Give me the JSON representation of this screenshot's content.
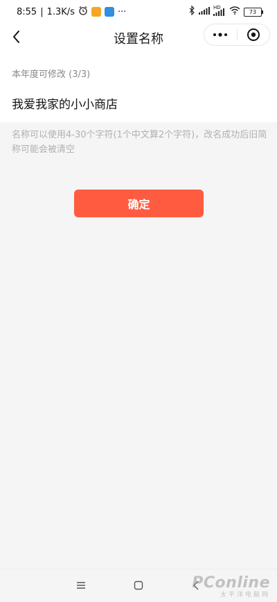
{
  "status_bar": {
    "time": "8:55",
    "speed": "1.3K/s",
    "network": "HD",
    "battery": "73",
    "more_dots": "···"
  },
  "nav": {
    "title": "设置名称"
  },
  "form": {
    "quota_label": "本年度可修改 (3/3)",
    "name_value": "我爱我家的小小商店"
  },
  "hint": "名称可以使用4-30个字符(1个中文算2个字符)，改名成功后旧简称可能会被清空",
  "confirm_label": "确定",
  "colors": {
    "accent": "#ff5b40",
    "page_bg": "#f5f5f5",
    "hint": "#b0b0b0"
  },
  "watermark": {
    "brand": "PConline",
    "sub": "太平洋电脑网"
  }
}
